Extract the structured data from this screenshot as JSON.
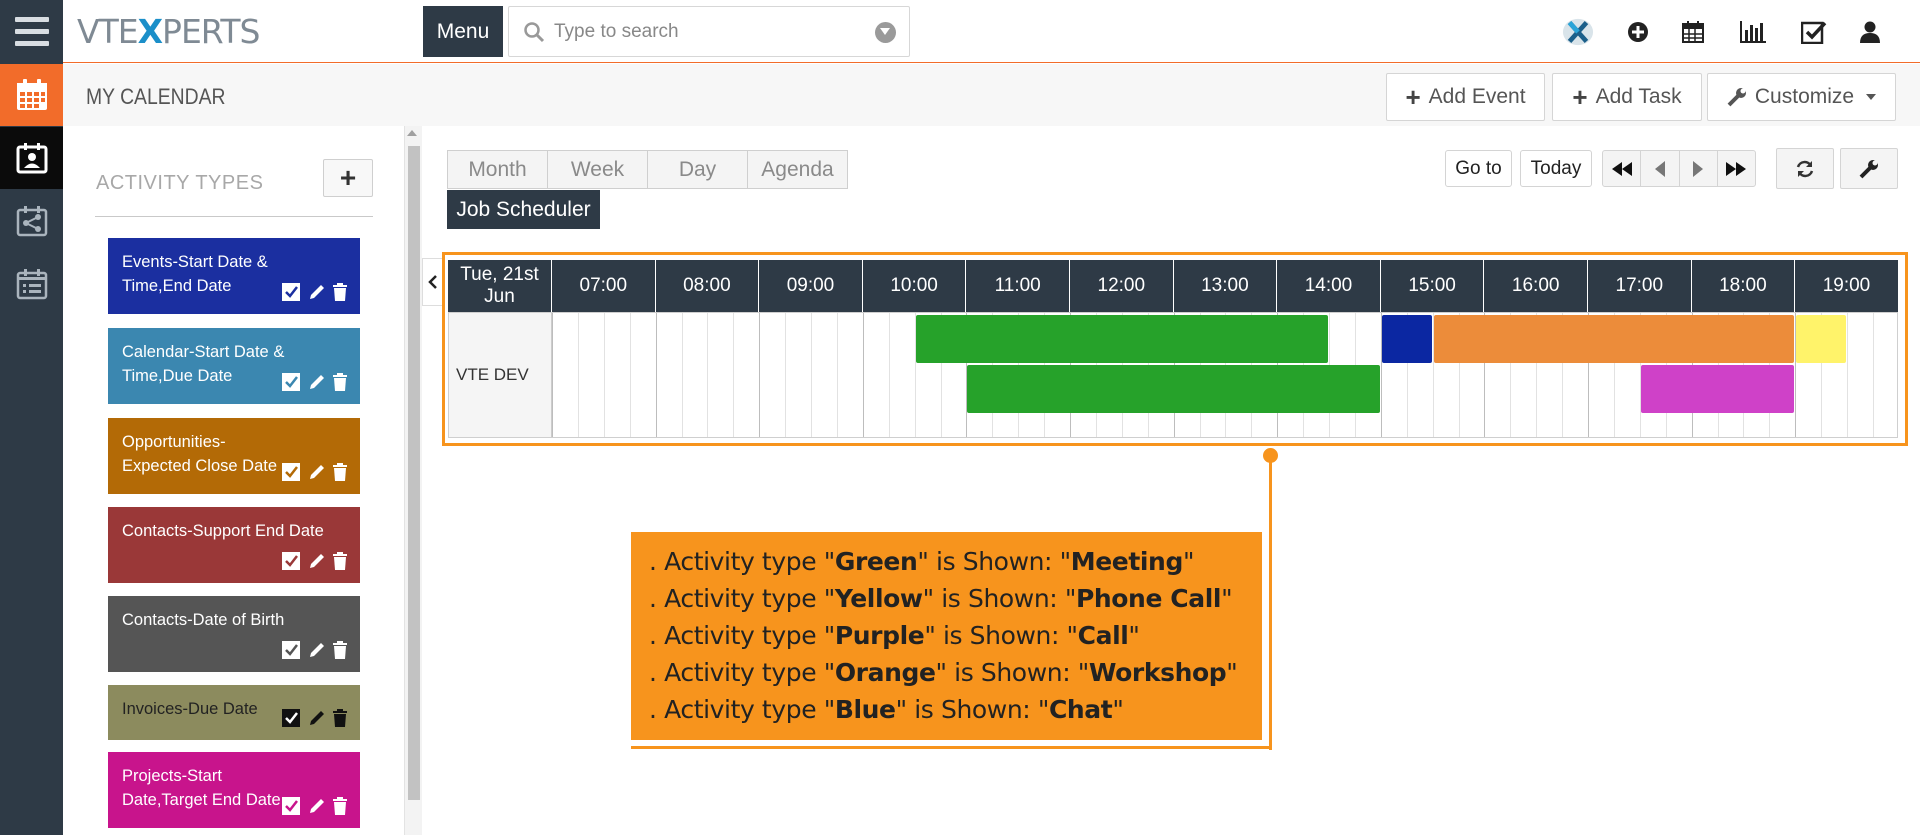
{
  "app": {
    "logo_left": "VTE",
    "logo_mark": "X",
    "logo_right": "PERTS",
    "menu_label": "Menu",
    "search_placeholder": "Type to search"
  },
  "page": {
    "title": "MY CALENDAR",
    "add_event_label": "Add Event",
    "add_task_label": "Add Task",
    "customize_label": "Customize"
  },
  "activity_types": {
    "title": "ACTIVITY TYPES",
    "add_label": "+",
    "items": [
      {
        "label": "Events-Start Date & Time,End Date",
        "color": "#1b2fa0"
      },
      {
        "label": "Calendar-Start Date & Time,Due Date",
        "color": "#3b87b0"
      },
      {
        "label": "Opportunities-Expected Close Date",
        "color": "#b36a06"
      },
      {
        "label": "Contacts-Support End Date",
        "color": "#9a3838"
      },
      {
        "label": "Contacts-Date of Birth",
        "color": "#555555"
      },
      {
        "label": "Invoices-Due Date",
        "color": "#8c8b5e"
      },
      {
        "label": "Projects-Start Date,Target End Date",
        "color": "#c8148c"
      }
    ]
  },
  "calendar": {
    "views": [
      "Month",
      "Week",
      "Day",
      "Agenda"
    ],
    "job_scheduler_label": "Job Scheduler",
    "goto_label": "Go to",
    "today_label": "Today",
    "date_header": "Tue, 21st Jun",
    "hours": [
      "07:00",
      "08:00",
      "09:00",
      "10:00",
      "11:00",
      "12:00",
      "13:00",
      "14:00",
      "15:00",
      "16:00",
      "17:00",
      "18:00",
      "19:00"
    ],
    "resource": "VTE DEV",
    "events": [
      {
        "color": "Green",
        "hex": "#26a22a",
        "start": "10:30",
        "end": "14:30",
        "lane": 1
      },
      {
        "color": "Green",
        "hex": "#26a22a",
        "start": "11:00",
        "end": "15:00",
        "lane": 2
      },
      {
        "color": "Blue",
        "hex": "#0b27a2",
        "start": "15:00",
        "end": "15:30",
        "lane": 1
      },
      {
        "color": "Orange",
        "hex": "#ec8c3a",
        "start": "15:30",
        "end": "19:00",
        "lane": 1
      },
      {
        "color": "Yellow",
        "hex": "#fff36a",
        "start": "19:00",
        "end": "19:30",
        "lane": 1
      },
      {
        "color": "Purple",
        "hex": "#cf41c8",
        "start": "17:30",
        "end": "19:00",
        "lane": 2
      }
    ]
  },
  "callout": {
    "items": [
      {
        "prefix": "Activity type \"",
        "color": "Green",
        "mid": "\" is Shown: \"",
        "type": "Meeting",
        "suffix": "\""
      },
      {
        "prefix": "Activity type \"",
        "color": "Yellow",
        "mid": "\" is Shown: \"",
        "type": "Phone Call",
        "suffix": "\""
      },
      {
        "prefix": "Activity type \"",
        "color": "Purple",
        "mid": "\" is Shown: \"",
        "type": "Call",
        "suffix": "\""
      },
      {
        "prefix": "Activity type \"",
        "color": "Orange",
        "mid": "\" is Shown: \"",
        "type": "Workshop",
        "suffix": "\""
      },
      {
        "prefix": "Activity type \"",
        "color": "Blue",
        "mid": "\" is Shown: \"",
        "type": "Chat",
        "suffix": "\""
      }
    ]
  },
  "icons": {
    "rail": [
      "hamburger-icon",
      "calendar-icon",
      "contact-calendar-icon",
      "share-icon",
      "list-calendar-icon"
    ],
    "topbar": [
      "vtexperts-icon",
      "add-icon",
      "calendar-icon",
      "chart-icon",
      "checkbox-icon",
      "user-icon"
    ]
  }
}
